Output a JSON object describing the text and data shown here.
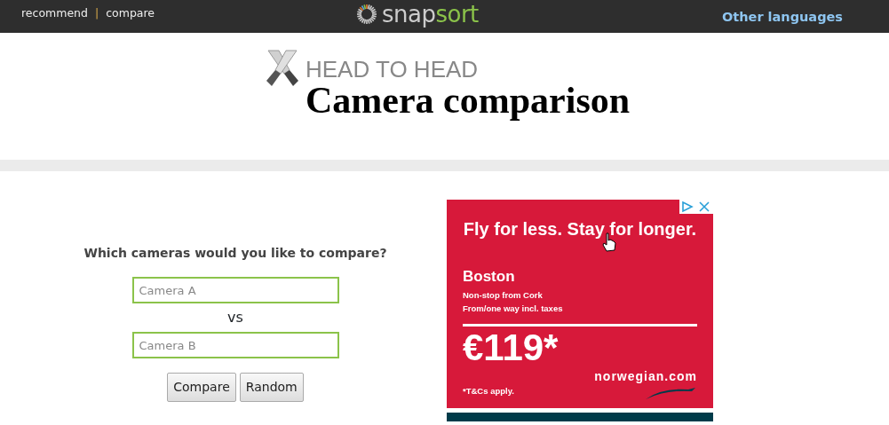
{
  "top_nav": {
    "links": [
      {
        "label": "recommend"
      },
      {
        "label": "compare"
      }
    ],
    "separator": "|",
    "logo": {
      "text_a": "snap",
      "text_b": "sort"
    },
    "languages_link": "Other languages"
  },
  "header": {
    "kicker": "HEAD TO HEAD",
    "title": "Camera comparison"
  },
  "form": {
    "question": "Which cameras would you like to compare?",
    "fields": [
      {
        "placeholder": "Camera A"
      },
      {
        "placeholder": "Camera B"
      }
    ],
    "vs": "vs",
    "buttons": [
      "Compare",
      "Random"
    ]
  },
  "ad": {
    "headline": "Fly for less. Stay for longer.",
    "city": "Boston",
    "lines": [
      "Non-stop from Cork",
      "From/one way incl. taxes"
    ],
    "price": "€119*",
    "brand": "norwegian.com",
    "terms": "*T&Cs apply."
  }
}
